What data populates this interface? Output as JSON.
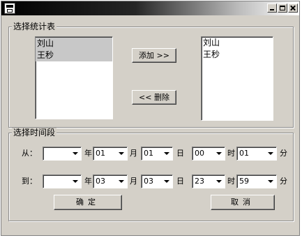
{
  "titlebar": {
    "minimize_icon": "minimize-icon",
    "maximize_icon": "maximize-icon",
    "close_icon": "close-icon"
  },
  "select_table": {
    "title": "选择统计表",
    "available": [
      "刘山",
      "王秒"
    ],
    "selected": [
      "刘山",
      "王秒"
    ],
    "add_label": "添加 >>",
    "delete_label": "<< 删除"
  },
  "select_time": {
    "title": "选择时间段",
    "from_label": "从：",
    "to_label": "到：",
    "unit_year": "年",
    "unit_month": "月",
    "unit_day": "日",
    "unit_hour": "时",
    "unit_minute": "分",
    "from": {
      "year": "",
      "month": "01",
      "day": "01",
      "hour": "00",
      "minute": "01"
    },
    "to": {
      "year": "",
      "month": "03",
      "day": "03",
      "hour": "23",
      "minute": "59"
    },
    "ok_label": "确定",
    "cancel_label": "取消"
  }
}
